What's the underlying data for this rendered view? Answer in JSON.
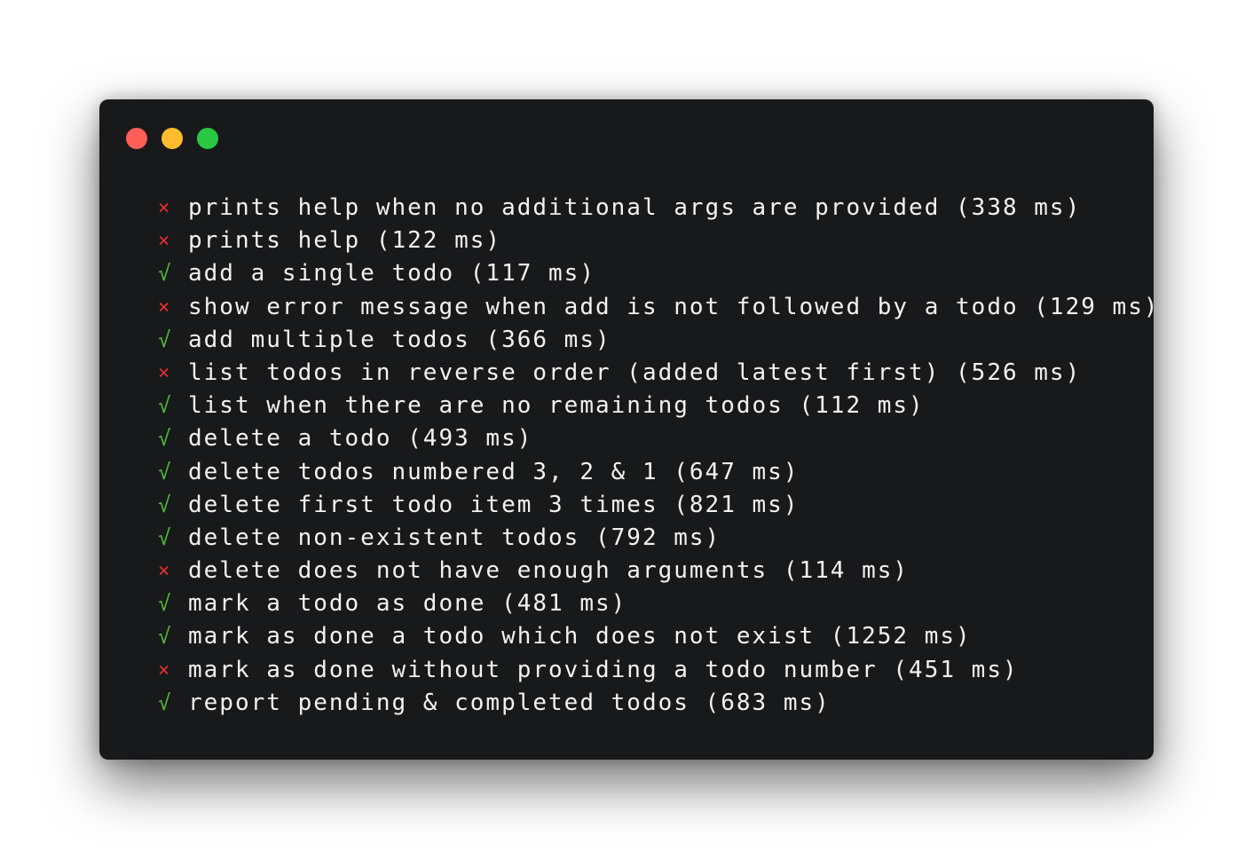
{
  "window": {
    "controls": [
      {
        "name": "close",
        "color": "#fe5f57"
      },
      {
        "name": "minimize",
        "color": "#febc2e"
      },
      {
        "name": "maximize",
        "color": "#28c840"
      }
    ]
  },
  "colors": {
    "pass": "#4eb839",
    "fail": "#e12f2f",
    "text": "#f2f2f2",
    "background": "#18191b"
  },
  "results": [
    {
      "status": "fail",
      "mark": "×",
      "text": "prints help when no additional args are provided (338 ms)"
    },
    {
      "status": "fail",
      "mark": "×",
      "text": "prints help (122 ms)"
    },
    {
      "status": "pass",
      "mark": "√",
      "text": "add a single todo (117 ms)"
    },
    {
      "status": "fail",
      "mark": "×",
      "text": "show error message when add is not followed by a todo (129 ms)"
    },
    {
      "status": "pass",
      "mark": "√",
      "text": "add multiple todos (366 ms)"
    },
    {
      "status": "fail",
      "mark": "×",
      "text": "list todos in reverse order (added latest first) (526 ms)"
    },
    {
      "status": "pass",
      "mark": "√",
      "text": "list when there are no remaining todos (112 ms)"
    },
    {
      "status": "pass",
      "mark": "√",
      "text": "delete a todo (493 ms)"
    },
    {
      "status": "pass",
      "mark": "√",
      "text": "delete todos numbered 3, 2 & 1 (647 ms)"
    },
    {
      "status": "pass",
      "mark": "√",
      "text": "delete first todo item 3 times (821 ms)"
    },
    {
      "status": "pass",
      "mark": "√",
      "text": "delete non-existent todos (792 ms)"
    },
    {
      "status": "fail",
      "mark": "×",
      "text": "delete does not have enough arguments (114 ms)"
    },
    {
      "status": "pass",
      "mark": "√",
      "text": "mark a todo as done (481 ms)"
    },
    {
      "status": "pass",
      "mark": "√",
      "text": "mark as done a todo which does not exist (1252 ms)"
    },
    {
      "status": "fail",
      "mark": "×",
      "text": "mark as done without providing a todo number (451 ms)"
    },
    {
      "status": "pass",
      "mark": "√",
      "text": "report pending & completed todos (683 ms)"
    }
  ]
}
